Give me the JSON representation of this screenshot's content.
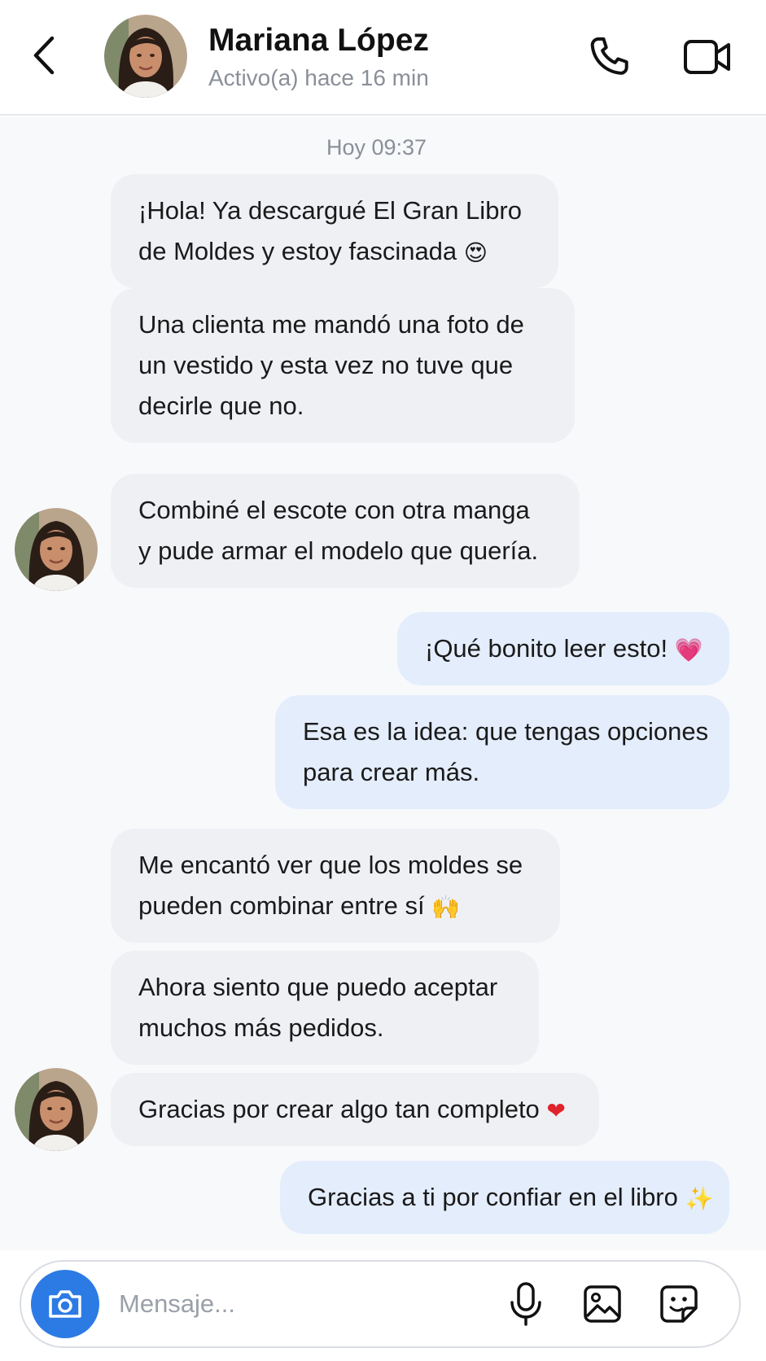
{
  "contact": {
    "name": "Mariana López",
    "status": "Activo(a) hace 16 min"
  },
  "icons": {
    "back": "chevron-left-icon",
    "call": "phone-icon",
    "video": "video-camera-icon",
    "camera": "camera-icon",
    "mic": "microphone-icon",
    "image": "image-icon",
    "sticker": "sticker-icon"
  },
  "colors": {
    "accent": "#2c7be5",
    "incoming_bubble": "#eef0f4",
    "outgoing_bubble": "#e4edfc",
    "chat_background": "#f8f9fb"
  },
  "chat": {
    "timestamp": "Hoy 09:37",
    "messages": [
      {
        "from": "contact",
        "lines": [
          "¡Hola! Ya descargué El Gran Libro",
          "de Moldes y estoy fascinada"
        ],
        "emoji": "😍"
      },
      {
        "from": "contact",
        "lines": [
          "Una clienta me mandó una foto de",
          "un vestido y esta vez no tuve que",
          "decirle que no."
        ]
      },
      {
        "from": "contact",
        "lines": [
          "Combiné el escote con otra manga",
          "y pude armar el modelo que quería."
        ]
      },
      {
        "from": "me",
        "lines": [
          "¡Qué bonito leer esto!"
        ],
        "emoji": "💗"
      },
      {
        "from": "me",
        "lines": [
          "Esa es la idea: que tengas opciones",
          "para crear más."
        ]
      },
      {
        "from": "contact",
        "lines": [
          "Me encantó ver que los moldes se",
          "pueden combinar entre sí"
        ],
        "emoji": "🙌"
      },
      {
        "from": "contact",
        "lines": [
          "Ahora siento que puedo aceptar",
          "muchos más pedidos."
        ]
      },
      {
        "from": "contact",
        "lines": [
          "Gracias por crear algo tan completo"
        ],
        "emoji": "❤"
      },
      {
        "from": "me",
        "lines": [
          "Gracias a ti por confiar en el libro"
        ],
        "emoji": "✨"
      }
    ]
  },
  "composer": {
    "placeholder": "Mensaje..."
  }
}
